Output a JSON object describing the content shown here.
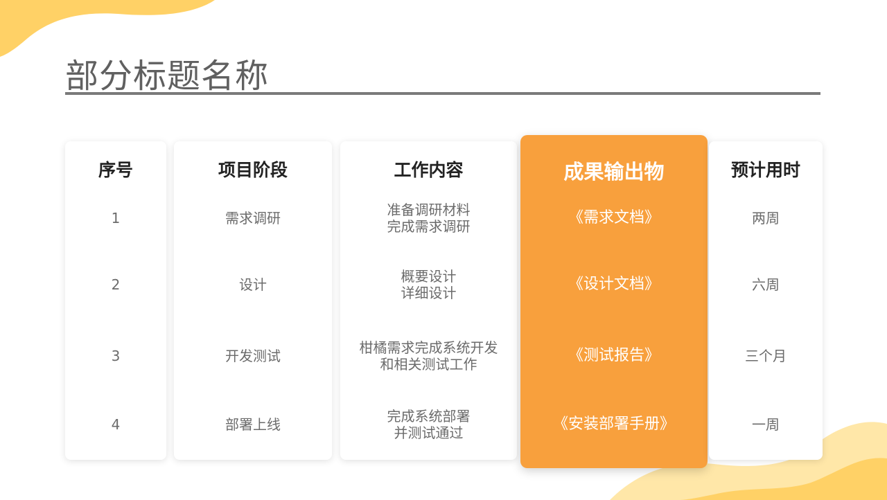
{
  "title": "部分标题名称",
  "columns": [
    {
      "header": "序号",
      "cells": [
        [
          "1"
        ],
        [
          "2"
        ],
        [
          "3"
        ],
        [
          "4"
        ]
      ]
    },
    {
      "header": "项目阶段",
      "cells": [
        [
          "需求调研"
        ],
        [
          "设计"
        ],
        [
          "开发测试"
        ],
        [
          "部署上线"
        ]
      ]
    },
    {
      "header": "工作内容",
      "cells": [
        [
          "准备调研材料",
          "完成需求调研"
        ],
        [
          "概要设计",
          "详细设计"
        ],
        [
          "柑橘需求完成系统开发",
          "和相关测试工作"
        ],
        [
          "完成系统部署",
          "并测试通过"
        ]
      ]
    },
    {
      "header": "成果输出物",
      "cells": [
        [
          "《需求文档》"
        ],
        [
          "《设计文档》"
        ],
        [
          "《测试报告》"
        ],
        [
          "《安装部署手册》"
        ]
      ]
    },
    {
      "header": "预计用时",
      "cells": [
        [
          "两周"
        ],
        [
          "六周"
        ],
        [
          "三个月"
        ],
        [
          "一周"
        ]
      ]
    }
  ],
  "colors": {
    "accent": "#f8a03d",
    "deco_yellow": "#ffd166",
    "rule": "#7a7a7a"
  }
}
